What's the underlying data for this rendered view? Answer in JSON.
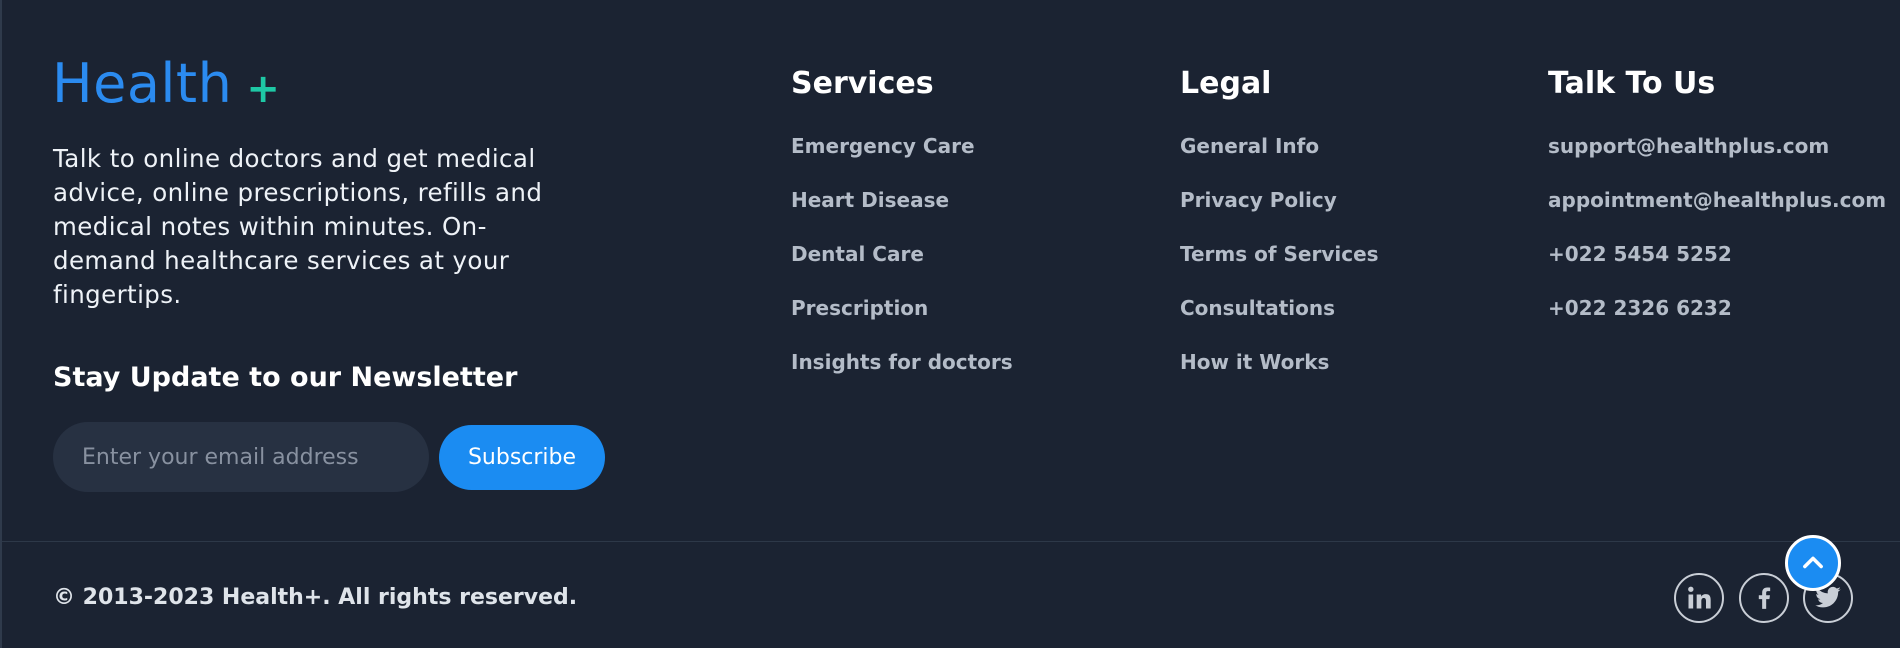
{
  "brand": {
    "name": "Health",
    "plus": "+"
  },
  "about": "Talk to online doctors and get medical advice, online prescriptions, refills and medical notes within minutes. On-demand healthcare services at your fingertips.",
  "newsletter": {
    "title": "Stay Update to our Newsletter",
    "placeholder": "Enter your email address",
    "button_label": "Subscribe"
  },
  "services": {
    "title": "Services",
    "items": [
      "Emergency Care",
      "Heart Disease",
      "Dental Care",
      "Prescription",
      "Insights for doctors"
    ]
  },
  "legal": {
    "title": "Legal",
    "items": [
      "General Info",
      "Privacy Policy",
      "Terms of Services",
      "Consultations",
      "How it Works"
    ]
  },
  "talk": {
    "title": "Talk To Us",
    "items": [
      "support@healthplus.com",
      "appointment@healthplus.com",
      "+022 5454 5252",
      "+022 2326 6232"
    ]
  },
  "footer": {
    "copyright": "© 2013-2023 Health+. All rights reserved."
  },
  "social": [
    "linkedin-icon",
    "facebook-icon",
    "twitter-icon"
  ],
  "colors": {
    "background": "#1b2332",
    "accent": "#1b8cf2",
    "plus": "#1ec8a5",
    "link": "#b4bcc8"
  }
}
